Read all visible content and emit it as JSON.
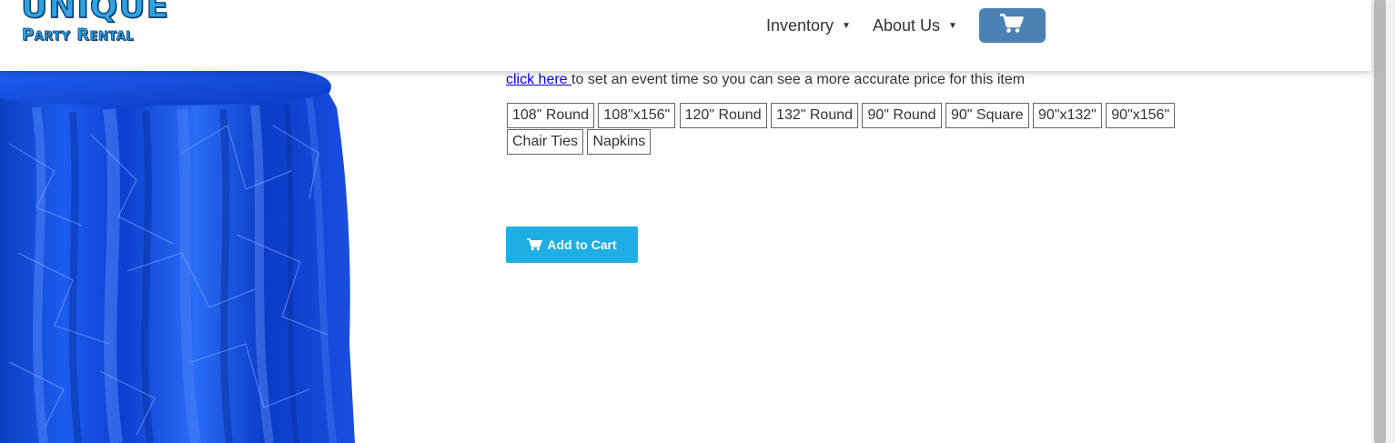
{
  "header": {
    "logo_line1": "UNIQUE",
    "logo_line2": "Party Rental",
    "nav": [
      {
        "label": "Inventory"
      },
      {
        "label": "About Us"
      }
    ],
    "cart_icon": "shopping-cart-icon"
  },
  "product": {
    "image_icon": "blue-crushed-satin-tablecloth",
    "price_note_link": "click here ",
    "price_note_text": "to set an event time so you can see a more accurate price for this item",
    "sizes": [
      "108\" Round",
      "108\"x156\"",
      "120\" Round",
      "132\" Round",
      "90\" Round",
      "90\" Square",
      "90\"x132\"",
      "90\"x156\"",
      "Chair Ties",
      "Napkins"
    ],
    "add_to_cart_label": "Add to Cart"
  },
  "colors": {
    "cart_button": "#4a82b5",
    "add_to_cart": "#1eaee3",
    "link": "#0000ee",
    "logo_blue": "#2ea3e0"
  }
}
